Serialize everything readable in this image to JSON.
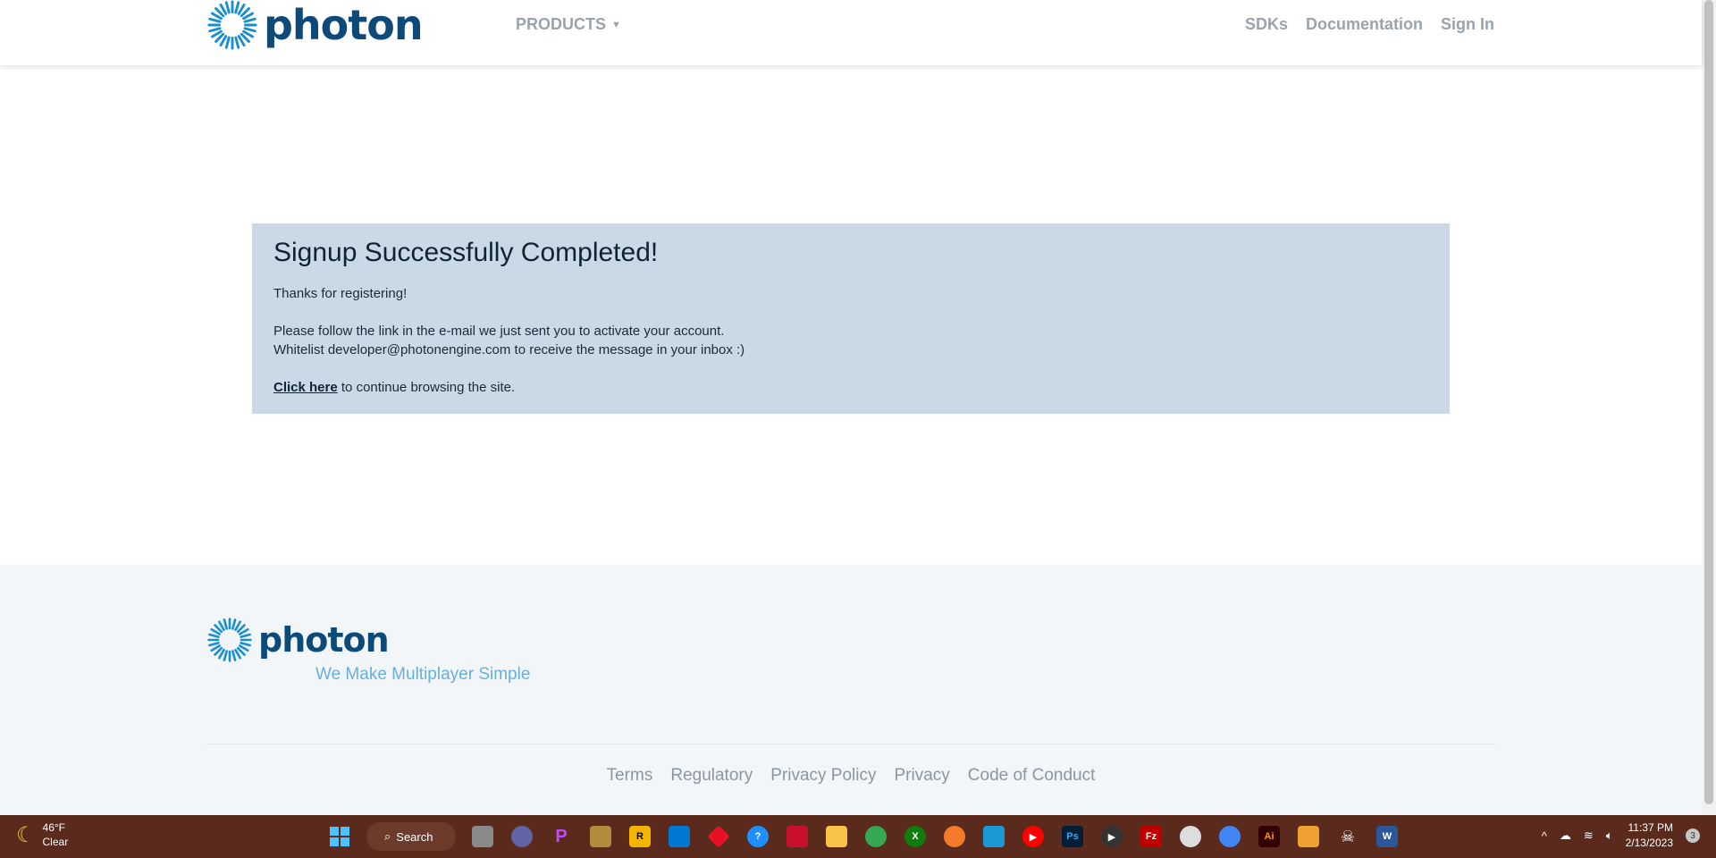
{
  "header": {
    "logo_text": "photon",
    "products_label": "PRODUCTS",
    "nav_links": [
      "SDKs",
      "Documentation",
      "Sign In"
    ]
  },
  "notice": {
    "title": "Signup Successfully Completed!",
    "line1": "Thanks for registering!",
    "line2": "Please follow the link in the e-mail we just sent you to activate your account.",
    "line3": "Whitelist developer@photonengine.com to receive the message in your inbox :)",
    "link_text": "Click here",
    "line4_rest": " to continue browsing the site."
  },
  "footer": {
    "logo_text": "photon",
    "tagline": "We Make Multiplayer Simple",
    "links": [
      "Terms",
      "Regulatory",
      "Privacy Policy",
      "Privacy",
      "Code of Conduct"
    ]
  },
  "taskbar": {
    "weather_temp": "46°F",
    "weather_desc": "Clear",
    "search_label": "Search",
    "time": "11:37 PM",
    "date": "2/13/2023",
    "notification_count": "3"
  },
  "colors": {
    "brand": "#0c4a7a",
    "notice_bg": "#cbd9e6",
    "tagline": "#6aaedc",
    "taskbar": "#5a2a1c"
  }
}
